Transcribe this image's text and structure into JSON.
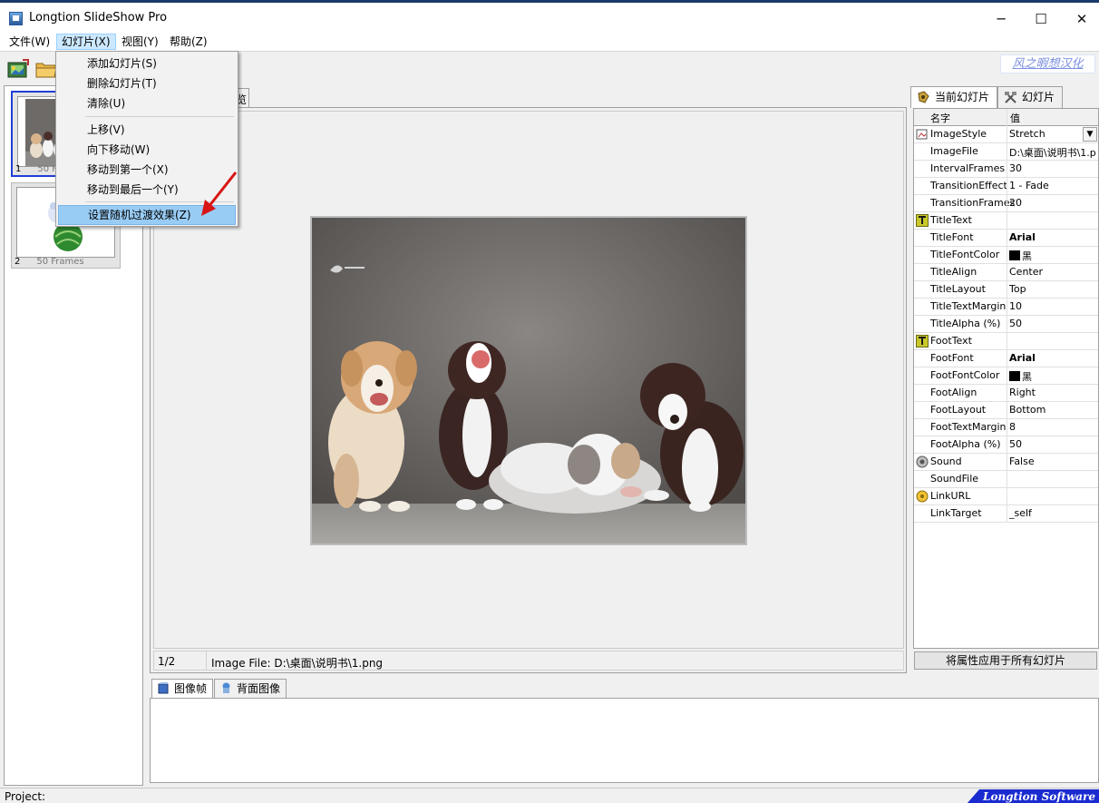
{
  "window": {
    "title": "Longtion SlideShow Pro",
    "controls": {
      "minimize": "─",
      "maximize": "☐",
      "close": "✕"
    }
  },
  "menubar": [
    {
      "label": "文件(W)"
    },
    {
      "label": "幻灯片(X)",
      "active": true
    },
    {
      "label": "视图(Y)"
    },
    {
      "label": "帮助(Z)"
    }
  ],
  "slides_menu": {
    "items": [
      {
        "label": "添加幻灯片(S)"
      },
      {
        "label": "删除幻灯片(T)"
      },
      {
        "label": "清除(U)"
      },
      {
        "label": "上移(V)"
      },
      {
        "label": "向下移动(W)"
      },
      {
        "label": "移动到第一个(X)"
      },
      {
        "label": "移动到最后一个(Y)"
      },
      {
        "label": "设置随机过渡效果(Z)",
        "highlighted": true
      }
    ]
  },
  "toolbar": {
    "brand_link": "风之暇想汉化"
  },
  "slides_list": [
    {
      "index": "1",
      "frames": "50 Frames",
      "selected": true
    },
    {
      "index": "2",
      "frames": "50 Frames",
      "selected": false
    }
  ],
  "preview": {
    "tab_label": "览",
    "status_index": "1/2",
    "status_file": "Image File: D:\\桌面\\说明书\\1.png"
  },
  "bottom_tabs": [
    {
      "label": "图像帧",
      "active": true
    },
    {
      "label": "背面图像",
      "active": false
    }
  ],
  "right_tabs": [
    {
      "label": "当前幻灯片",
      "active": true
    },
    {
      "label": "幻灯片",
      "active": false
    }
  ],
  "properties": {
    "header_name": "名字",
    "header_value": "值",
    "rows": [
      {
        "name": "ImageStyle",
        "value": "Stretch",
        "icon": "image-style-icon",
        "dropdown": true
      },
      {
        "name": "ImageFile",
        "value": "D:\\桌面\\说明书\\1.png"
      },
      {
        "name": "IntervalFrames",
        "value": "30"
      },
      {
        "name": "TransitionEffect",
        "value": "1 - Fade"
      },
      {
        "name": "TransitionFrames",
        "value": "20"
      },
      {
        "name": "TitleText",
        "value": "",
        "icon": "text-t-icon"
      },
      {
        "name": "TitleFont",
        "value": "Arial",
        "bold": true
      },
      {
        "name": "TitleFontColor",
        "value": "黑",
        "swatch": "#000000"
      },
      {
        "name": "TitleAlign",
        "value": "Center"
      },
      {
        "name": "TitleLayout",
        "value": "Top"
      },
      {
        "name": "TitleTextMargin",
        "value": "10"
      },
      {
        "name": "TitleAlpha (%)",
        "value": "50"
      },
      {
        "name": "FootText",
        "value": "",
        "icon": "text-t-icon"
      },
      {
        "name": "FootFont",
        "value": "Arial",
        "bold": true
      },
      {
        "name": "FootFontColor",
        "value": "黑",
        "swatch": "#000000"
      },
      {
        "name": "FootAlign",
        "value": "Right"
      },
      {
        "name": "FootLayout",
        "value": "Bottom"
      },
      {
        "name": "FootTextMargin",
        "value": "8"
      },
      {
        "name": "FootAlpha (%)",
        "value": "50"
      },
      {
        "name": "Sound",
        "value": "False",
        "icon": "speaker-icon"
      },
      {
        "name": "SoundFile",
        "value": ""
      },
      {
        "name": "LinkURL",
        "value": "",
        "icon": "link-icon"
      },
      {
        "name": "LinkTarget",
        "value": "_self"
      }
    ],
    "apply_button": "将属性应用于所有幻灯片"
  },
  "statusbar": {
    "project_label": "Project:",
    "company": "Longtion Software"
  },
  "colors": {
    "menu_highlight": "#99ccf5",
    "selected_thumb_border": "#1f3ed6",
    "company_badge": "#1a2bd0"
  }
}
